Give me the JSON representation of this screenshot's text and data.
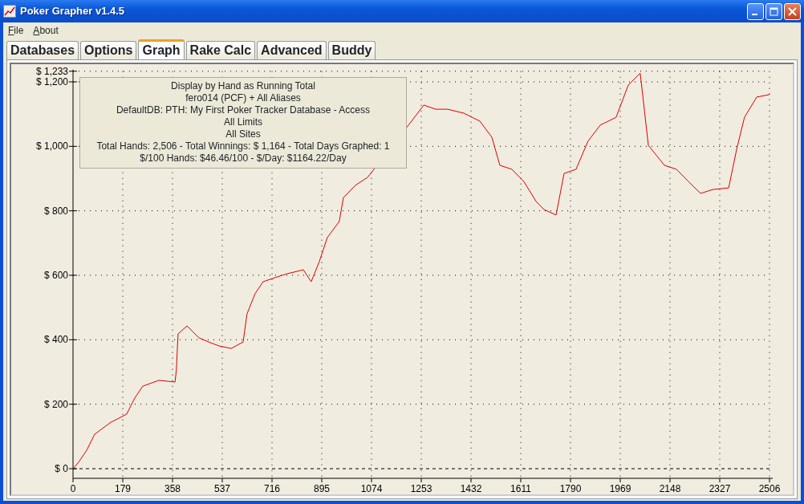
{
  "window": {
    "title": "Poker Grapher v1.4.5"
  },
  "menu": [
    "File",
    "About"
  ],
  "tabs": [
    {
      "label": "Databases",
      "selected": false
    },
    {
      "label": "Options",
      "selected": false
    },
    {
      "label": "Graph",
      "selected": true
    },
    {
      "label": "Rake Calc",
      "selected": false
    },
    {
      "label": "Advanced",
      "selected": false
    },
    {
      "label": "Buddy",
      "selected": false
    }
  ],
  "graph": {
    "info_lines": [
      "Display by Hand as Running Total",
      "fero014 (PCF) + All Aliases",
      "DefaultDB: PTH: My First Poker Tracker Database - Access",
      "All Limits",
      "All Sites",
      "Total Hands: 2,506 - Total Winnings: $ 1,164 - Total Days Graphed: 1",
      "$/100 Hands: $46.46/100 - $/Day: $1164.22/Day"
    ],
    "chart_data": {
      "type": "line",
      "x": [
        0,
        20,
        49,
        78,
        136,
        193,
        222,
        251,
        309,
        367,
        372,
        378,
        410,
        453,
        488,
        525,
        569,
        612,
        626,
        655,
        684,
        728,
        771,
        829,
        857,
        886,
        915,
        958,
        973,
        1016,
        1060,
        1218,
        1262,
        1305,
        1348,
        1406,
        1464,
        1507,
        1536,
        1579,
        1622,
        1666,
        1695,
        1738,
        1767,
        1810,
        1853,
        1897,
        1954,
        1998,
        2041,
        2070,
        2128,
        2171,
        2214,
        2258,
        2301,
        2359,
        2388,
        2416,
        2460,
        2503,
        2506
      ],
      "series": [
        {
          "color": "#dd0000",
          "values": [
            0,
            20,
            57,
            107,
            144,
            169,
            219,
            256,
            274,
            269,
            306,
            418,
            443,
            406,
            393,
            381,
            373,
            393,
            480,
            543,
            580,
            593,
            605,
            617,
            580,
            642,
            717,
            767,
            841,
            879,
            904,
            1078,
            1128,
            1115,
            1115,
            1103,
            1078,
            1028,
            941,
            929,
            891,
            829,
            804,
            787,
            916,
            929,
            1016,
            1066,
            1090,
            1190,
            1227,
            1003,
            941,
            929,
            891,
            854,
            866,
            871,
            991,
            1090,
            1153,
            1160,
            1164
          ]
        }
      ],
      "grid": true,
      "xlim": [
        0,
        2506
      ],
      "ylim": [
        0,
        1233
      ],
      "xticks": [
        0,
        179,
        358,
        537,
        716,
        895,
        1074,
        1253,
        1432,
        1611,
        1790,
        1969,
        2148,
        2327,
        2506
      ],
      "yticks": [
        {
          "value": 0,
          "label": "$ 0"
        },
        {
          "value": 200,
          "label": "$ 200"
        },
        {
          "value": 400,
          "label": "$ 400"
        },
        {
          "value": 600,
          "label": "$ 600"
        },
        {
          "value": 800,
          "label": "$ 800"
        },
        {
          "value": 1000,
          "label": "$ 1,000"
        },
        {
          "value": 1200,
          "label": "$ 1,200"
        },
        {
          "value": 1233,
          "label": "$ 1,233"
        }
      ]
    }
  }
}
